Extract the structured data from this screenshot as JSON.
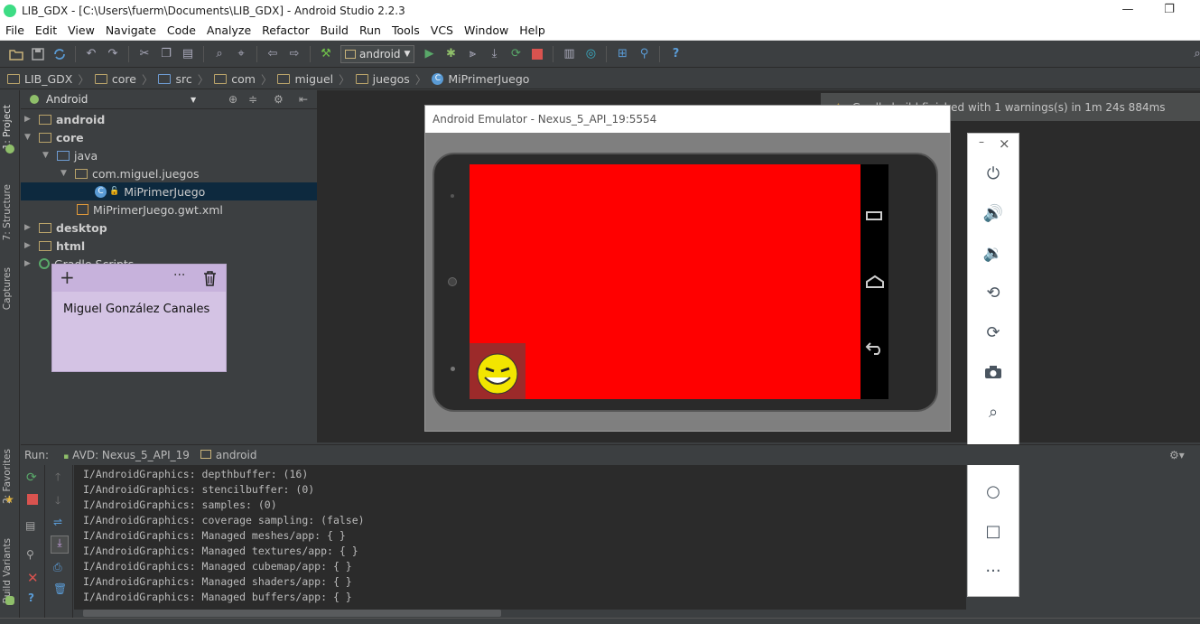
{
  "window": {
    "title": "LIB_GDX - [C:\\Users\\fuerm\\Documents\\LIB_GDX] - Android Studio 2.2.3",
    "minimize": "—",
    "restore": "❐"
  },
  "menu": [
    "File",
    "Edit",
    "View",
    "Navigate",
    "Code",
    "Analyze",
    "Refactor",
    "Build",
    "Run",
    "Tools",
    "VCS",
    "Window",
    "Help"
  ],
  "toolbar": {
    "run_config": "android",
    "help": "?"
  },
  "breadcrumb": [
    "LIB_GDX",
    "core",
    "src",
    "com",
    "miguel",
    "juegos",
    "MiPrimerJuego"
  ],
  "left_tabs": [
    "1: Project",
    "7: Structure",
    "Captures",
    "2: Favorites",
    "Build Variants"
  ],
  "project": {
    "view_mode": "Android",
    "tree": [
      {
        "label": "android",
        "level": 0,
        "expanded": false
      },
      {
        "label": "core",
        "level": 0,
        "expanded": true
      },
      {
        "label": "java",
        "level": 1,
        "expanded": true
      },
      {
        "label": "com.miguel.juegos",
        "level": 2,
        "expanded": true
      },
      {
        "label": "MiPrimerJuego",
        "level": 3,
        "selected": true
      },
      {
        "label": "MiPrimerJuego.gwt.xml",
        "level": 2
      },
      {
        "label": "desktop",
        "level": 0,
        "expanded": false
      },
      {
        "label": "html",
        "level": 0,
        "expanded": false
      },
      {
        "label": "Gradle Scripts",
        "level": 0,
        "expanded": false
      }
    ]
  },
  "notification": {
    "text": "Gradle build finished with 1 warnings(s) in 1m 24s 884ms"
  },
  "emulator": {
    "title": "Android Emulator - Nexus_5_API_19:5554",
    "screen_color": "#ff0000",
    "controls": [
      "power",
      "volume-up",
      "volume-down",
      "rotate-left",
      "rotate-right",
      "camera",
      "zoom",
      "back",
      "home",
      "overview",
      "more"
    ],
    "minimize": "–",
    "close": "×"
  },
  "sticky_note": {
    "text": "Miguel González Canales",
    "add": "+",
    "menu": "···"
  },
  "run_panel": {
    "label": "Run:",
    "tabs": [
      "AVD: Nexus_5_API_19",
      "android"
    ],
    "log": [
      "I/AndroidGraphics: depthbuffer: (16)",
      "I/AndroidGraphics: stencilbuffer: (0)",
      "I/AndroidGraphics: samples: (0)",
      "I/AndroidGraphics: coverage sampling: (false)",
      "I/AndroidGraphics: Managed meshes/app: { }",
      "I/AndroidGraphics: Managed textures/app: { }",
      "I/AndroidGraphics: Managed cubemap/app: { }",
      "I/AndroidGraphics: Managed shaders/app: { }",
      "I/AndroidGraphics: Managed buffers/app: { }"
    ]
  }
}
